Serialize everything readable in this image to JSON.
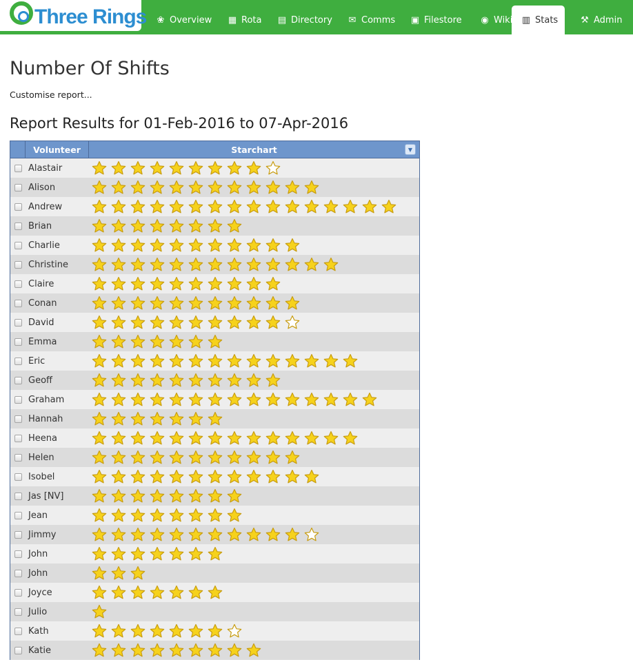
{
  "logo": {
    "text": "Three Rings"
  },
  "nav": {
    "items": [
      {
        "label": "Overview",
        "icon": "overview-icon",
        "active": false
      },
      {
        "label": "Rota",
        "icon": "calendar-icon",
        "active": false
      },
      {
        "label": "Directory",
        "icon": "directory-icon",
        "active": false
      },
      {
        "label": "Comms",
        "icon": "comms-icon",
        "active": false
      },
      {
        "label": "Filestore",
        "icon": "filestore-icon",
        "active": false
      },
      {
        "label": "Wiki",
        "icon": "globe-icon",
        "active": false
      },
      {
        "label": "Stats",
        "icon": "stats-icon",
        "active": true
      },
      {
        "label": "Admin",
        "icon": "tools-icon",
        "active": false
      }
    ]
  },
  "page": {
    "title": "Number Of Shifts",
    "customise_label": "Customise report...",
    "results_title": "Report Results for 01-Feb-2016 to 07-Apr-2016"
  },
  "table": {
    "headers": {
      "volunteer": "Volunteer",
      "starchart": "Starchart"
    },
    "rows": [
      {
        "name": "Alastair",
        "stars": 9.5
      },
      {
        "name": "Alison",
        "stars": 12
      },
      {
        "name": "Andrew",
        "stars": 16
      },
      {
        "name": "Brian",
        "stars": 8
      },
      {
        "name": "Charlie",
        "stars": 11
      },
      {
        "name": "Christine",
        "stars": 13
      },
      {
        "name": "Claire",
        "stars": 10
      },
      {
        "name": "Conan",
        "stars": 11
      },
      {
        "name": "David",
        "stars": 10.5
      },
      {
        "name": "Emma",
        "stars": 7
      },
      {
        "name": "Eric",
        "stars": 14
      },
      {
        "name": "Geoff",
        "stars": 10
      },
      {
        "name": "Graham",
        "stars": 15
      },
      {
        "name": "Hannah",
        "stars": 7
      },
      {
        "name": "Heena",
        "stars": 14
      },
      {
        "name": "Helen",
        "stars": 11
      },
      {
        "name": "Isobel",
        "stars": 12
      },
      {
        "name": "Jas [NV]",
        "stars": 8
      },
      {
        "name": "Jean",
        "stars": 8
      },
      {
        "name": "Jimmy",
        "stars": 11.5
      },
      {
        "name": "John",
        "stars": 7
      },
      {
        "name": "John",
        "stars": 3
      },
      {
        "name": "Joyce",
        "stars": 7
      },
      {
        "name": "Julio",
        "stars": 1
      },
      {
        "name": "Kath",
        "stars": 7.5
      },
      {
        "name": "Katie",
        "stars": 9
      }
    ]
  },
  "colors": {
    "nav_green": "#3fae3f",
    "logo_blue": "#2d8ed1",
    "header_blue": "#6e96cc",
    "star_fill": "#f6d21c",
    "star_stroke": "#c89d12"
  }
}
